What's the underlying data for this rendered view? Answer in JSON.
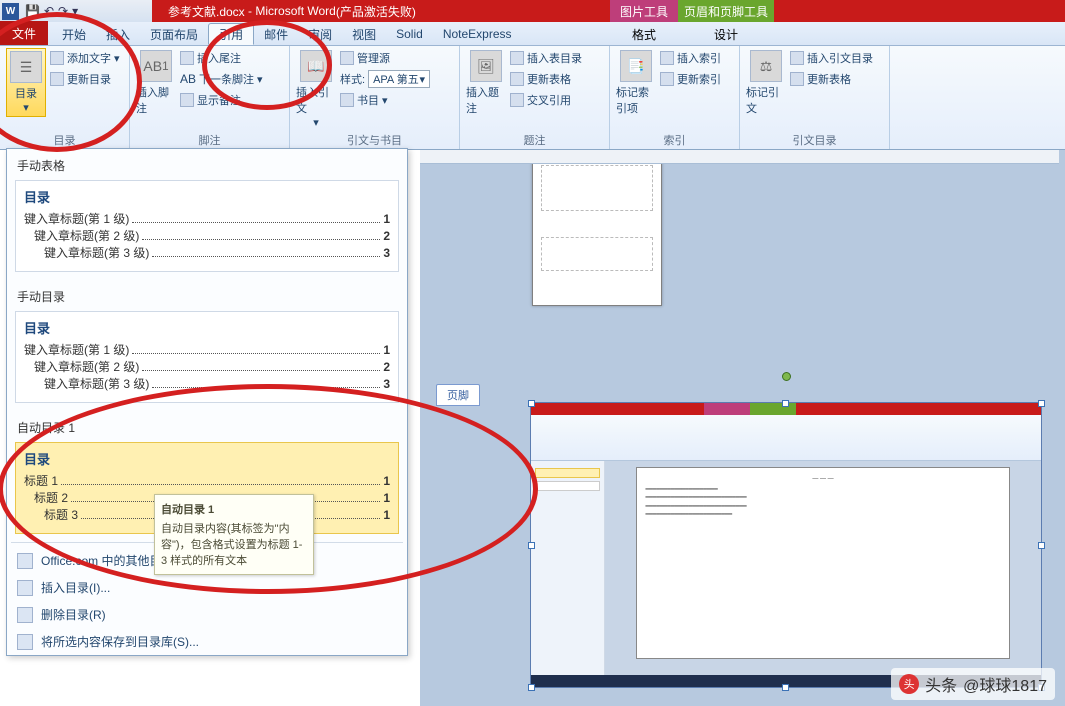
{
  "title": {
    "doc": "参考文献.docx",
    "app": "Microsoft Word",
    "status": "(产品激活失败)"
  },
  "tool_tabs": {
    "pic": "图片工具",
    "hf": "页眉和页脚工具"
  },
  "tool_subtabs": {
    "format": "格式",
    "design": "设计"
  },
  "tabs": {
    "file": "文件",
    "home": "开始",
    "insert": "插入",
    "layout": "页面布局",
    "ref": "引用",
    "mail": "邮件",
    "review": "审阅",
    "view": "视图",
    "solid": "Solid",
    "note": "NoteExpress"
  },
  "ribbon": {
    "toc": {
      "btn": "目录",
      "add_text": "添加文字",
      "update": "更新目录",
      "group": "目录"
    },
    "footnote": {
      "insert": "插入脚注",
      "ab": "AB",
      "insert_end": "插入尾注",
      "next": "下一条脚注",
      "show": "显示备注",
      "group": "脚注"
    },
    "citation": {
      "insert": "插入引文",
      "manage": "管理源",
      "style_lbl": "样式:",
      "style_val": "APA 第五",
      "biblio": "书目",
      "group": "引文与书目"
    },
    "caption": {
      "insert": "插入题注",
      "insert_tof": "插入表目录",
      "update_tof": "更新表格",
      "cross": "交叉引用",
      "group": "题注"
    },
    "index": {
      "mark": "标记索引项",
      "insert": "插入索引",
      "update": "更新索引",
      "group": "索引"
    },
    "toa": {
      "mark": "标记引文",
      "insert": "插入引文目录",
      "update": "更新表格",
      "group": "引文目录"
    }
  },
  "gallery": {
    "manual_table": "手动表格",
    "manual_toc": "手动目录",
    "auto1": "自动目录 1",
    "toc_header": "目录",
    "m_items": [
      {
        "lbl": "键入章标题(第 1 级)",
        "pg": "1",
        "indent": 0
      },
      {
        "lbl": "键入章标题(第 2 级)",
        "pg": "2",
        "indent": 1
      },
      {
        "lbl": "键入章标题(第 3 级)",
        "pg": "3",
        "indent": 2
      }
    ],
    "m2_items": [
      {
        "lbl": "键入章标题(第 1 级)",
        "pg": "1",
        "indent": 0
      },
      {
        "lbl": "键入章标题(第 2 级)",
        "pg": "2",
        "indent": 1
      },
      {
        "lbl": "键入章标题(第 3 级)",
        "pg": "3",
        "indent": 2
      }
    ],
    "a_items": [
      {
        "lbl": "标题 1",
        "pg": "1",
        "indent": 0
      },
      {
        "lbl": "标题 2",
        "pg": "1",
        "indent": 1
      },
      {
        "lbl": "标题 3",
        "pg": "1",
        "indent": 2
      }
    ],
    "tooltip_title": "自动目录 1",
    "tooltip_body": "自动目录内容(其标签为\"内容\")，包含格式设置为标题 1-3 样式的所有文本",
    "more": "Office.com 中的其他目录(M)",
    "insert": "插入目录(I)...",
    "remove": "删除目录(R)",
    "save": "将所选内容保存到目录库(S)..."
  },
  "footer_tag": "页脚",
  "watermark": {
    "prefix": "头条",
    "user": "@球球1817"
  }
}
